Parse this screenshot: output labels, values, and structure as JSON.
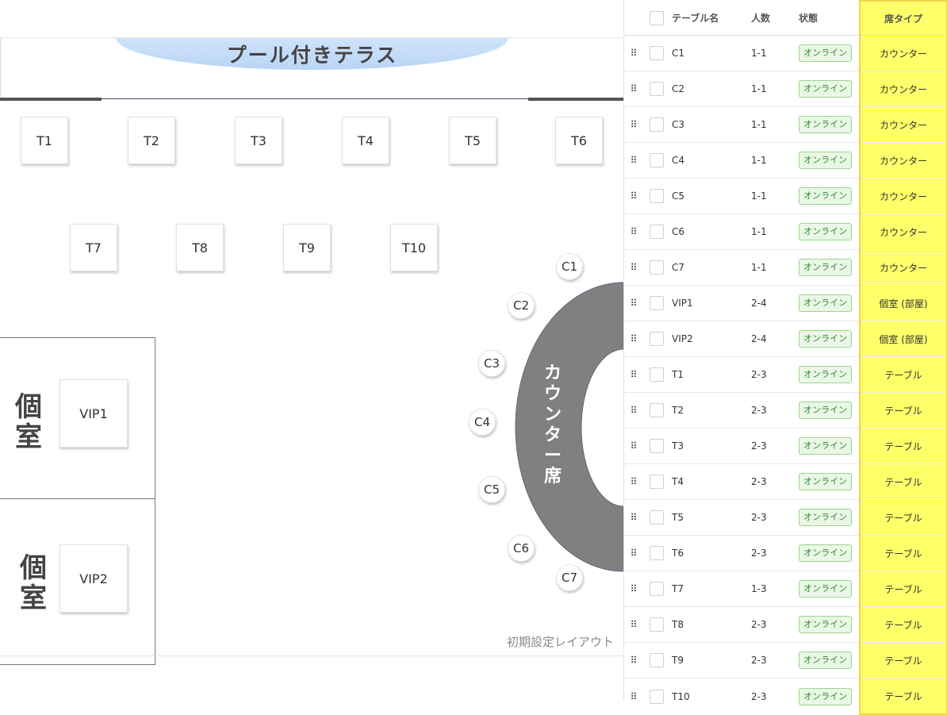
{
  "floor": {
    "terrace_title": "プール付きテラス",
    "tables": [
      "T1",
      "T2",
      "T3",
      "T4",
      "T5",
      "T6",
      "T7",
      "T8",
      "T9",
      "T10"
    ],
    "rooms": [
      {
        "label": "個室",
        "table": "VIP1"
      },
      {
        "label": "個室",
        "table": "VIP2"
      }
    ],
    "counter_label": "カウンター席",
    "counter_seats": [
      "C1",
      "C2",
      "C3",
      "C4",
      "C5",
      "C6",
      "C7"
    ],
    "layout_caption": "初期設定レイアウト",
    "counter_color": "#808080",
    "terrace_color": "#c4dcf7"
  },
  "grid": {
    "headers": {
      "name": "テーブル名",
      "capacity": "人数",
      "status": "状態",
      "seat_type": "席タイプ"
    },
    "highlight_color": "#ffff6a",
    "rows": [
      {
        "name": "C1",
        "capacity": "1-1",
        "status": "オンライン",
        "seat_type": "カウンター"
      },
      {
        "name": "C2",
        "capacity": "1-1",
        "status": "オンライン",
        "seat_type": "カウンター"
      },
      {
        "name": "C3",
        "capacity": "1-1",
        "status": "オンライン",
        "seat_type": "カウンター"
      },
      {
        "name": "C4",
        "capacity": "1-1",
        "status": "オンライン",
        "seat_type": "カウンター"
      },
      {
        "name": "C5",
        "capacity": "1-1",
        "status": "オンライン",
        "seat_type": "カウンター"
      },
      {
        "name": "C6",
        "capacity": "1-1",
        "status": "オンライン",
        "seat_type": "カウンター"
      },
      {
        "name": "C7",
        "capacity": "1-1",
        "status": "オンライン",
        "seat_type": "カウンター"
      },
      {
        "name": "VIP1",
        "capacity": "2-4",
        "status": "オンライン",
        "seat_type": "個室 (部屋)"
      },
      {
        "name": "VIP2",
        "capacity": "2-4",
        "status": "オンライン",
        "seat_type": "個室 (部屋)"
      },
      {
        "name": "T1",
        "capacity": "2-3",
        "status": "オンライン",
        "seat_type": "テーブル"
      },
      {
        "name": "T2",
        "capacity": "2-3",
        "status": "オンライン",
        "seat_type": "テーブル"
      },
      {
        "name": "T3",
        "capacity": "2-3",
        "status": "オンライン",
        "seat_type": "テーブル"
      },
      {
        "name": "T4",
        "capacity": "2-3",
        "status": "オンライン",
        "seat_type": "テーブル"
      },
      {
        "name": "T5",
        "capacity": "2-3",
        "status": "オンライン",
        "seat_type": "テーブル"
      },
      {
        "name": "T6",
        "capacity": "2-3",
        "status": "オンライン",
        "seat_type": "テーブル"
      },
      {
        "name": "T7",
        "capacity": "1-3",
        "status": "オンライン",
        "seat_type": "テーブル"
      },
      {
        "name": "T8",
        "capacity": "2-3",
        "status": "オンライン",
        "seat_type": "テーブル"
      },
      {
        "name": "T9",
        "capacity": "2-3",
        "status": "オンライン",
        "seat_type": "テーブル"
      },
      {
        "name": "T10",
        "capacity": "2-3",
        "status": "オンライン",
        "seat_type": "テーブル"
      }
    ]
  }
}
